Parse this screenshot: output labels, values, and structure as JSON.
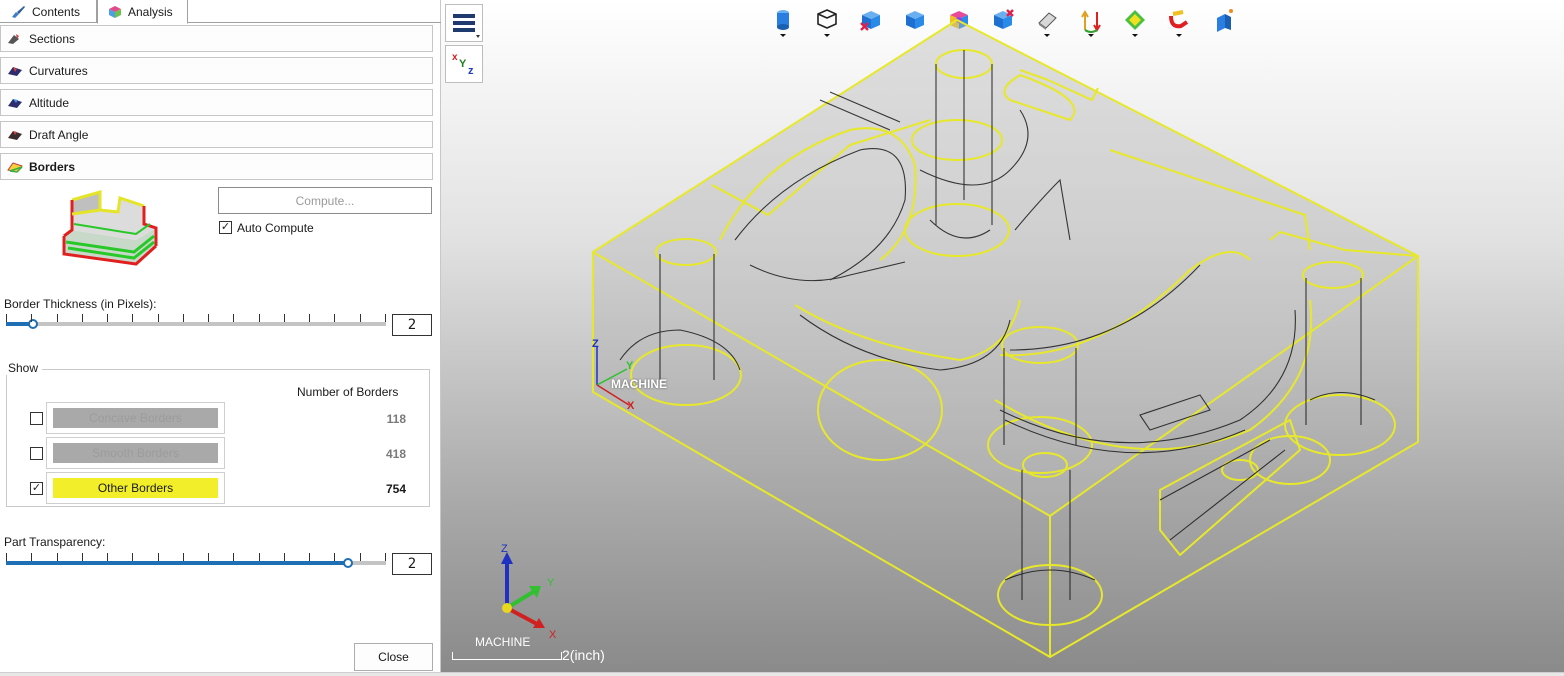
{
  "tabs": [
    {
      "label": "Contents",
      "icon": "brush-icon"
    },
    {
      "label": "Analysis",
      "icon": "cube-analysis-icon"
    }
  ],
  "sections": [
    {
      "label": "Sections",
      "icon": "sections-icon"
    },
    {
      "label": "Curvatures",
      "icon": "curvature-icon"
    },
    {
      "label": "Altitude",
      "icon": "altitude-icon"
    },
    {
      "label": "Draft Angle",
      "icon": "draft-angle-icon"
    },
    {
      "label": "Borders",
      "icon": "borders-icon",
      "active": true
    }
  ],
  "borders_panel": {
    "compute_label": "Compute...",
    "auto_compute_label": "Auto Compute",
    "auto_compute_checked": true,
    "thickness_label": "Border Thickness (in Pixels):",
    "thickness_value": "2",
    "thickness_level": 0.07,
    "show_label": "Show",
    "number_header": "Number of Borders",
    "rows": [
      {
        "label": "Concave Borders",
        "count": "118",
        "checked": false,
        "color": "#a9a9a9",
        "text_color": "#9c9c9c"
      },
      {
        "label": "Smooth Borders",
        "count": "418",
        "checked": false,
        "color": "#a9a9a9",
        "text_color": "#9c9c9c"
      },
      {
        "label": "Other Borders",
        "count": "754",
        "checked": true,
        "color": "#f2ef2a",
        "text_color": "#1a1a1a"
      }
    ],
    "transparency_label": "Part Transparency:",
    "transparency_value": "2",
    "transparency_level": 0.9,
    "close_label": "Close"
  },
  "viewport": {
    "csys_label": "MACHINE",
    "triad_label": "MACHINE",
    "scale_label": "2(inch)",
    "axis": {
      "x": "X",
      "y": "Y",
      "z": "Z"
    },
    "border_color": "#e8e82a",
    "toolbar_icons": [
      "cylinder-icon",
      "wireframe-cube-icon",
      "cube-x-icon",
      "blue-cube-icon",
      "colored-cube-icon",
      "cube-delete-icon",
      "erase-icon",
      "arrows-icon",
      "diamond-icon",
      "magnet-icon",
      "probe-icon"
    ]
  }
}
